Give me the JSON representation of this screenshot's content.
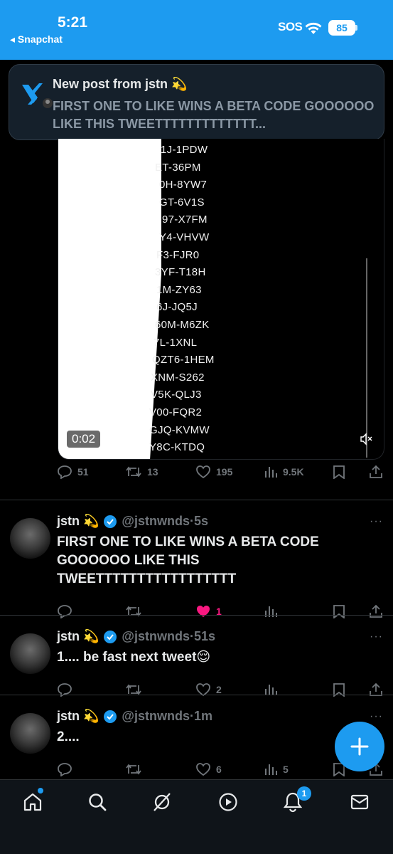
{
  "status_bar": {
    "time": "5:21",
    "back_app": "◂ Snapchat",
    "sos": "SOS",
    "battery": "85"
  },
  "notification": {
    "title": "New post from jstn 💫",
    "body": "FIRST ONE TO LIKE WINS A BETA CODE GOOOOOO LIKE THIS TWEETTTTTTTTTTTTT..."
  },
  "video": {
    "codes": [
      "1J-1PDW",
      "ET-36PM",
      "0H-8YW7",
      "GT-6V1S",
      "97-X7FM",
      "Y4-VHVW",
      "F3-FJR0",
      "3YF-T18H",
      "1M-ZY63",
      "6J-JQ5J",
      "60M-M6ZK",
      "7L-1XNL",
      "QZT6-1HEM",
      "XNM-S262",
      "V5K-QLJ3",
      "V00-FQR2",
      "GJQ-KVMW",
      "Y8C-KTDQ"
    ],
    "timestamp": "0:02"
  },
  "first_post_actions": {
    "replies": "51",
    "reposts": "13",
    "likes": "195",
    "views": "9.5K"
  },
  "tweets": [
    {
      "name": "jstn 💫",
      "handle": "@jstnwnds",
      "time": "·5s",
      "text": "FIRST ONE TO LIKE WINS A BETA CODE GOOOOOO LIKE THIS TWEETTTTTTTTTTTTTTTTT",
      "likes": "1",
      "liked": true,
      "views": ""
    },
    {
      "name": "jstn 💫",
      "handle": "@jstnwnds",
      "time": "·51s",
      "text": "1.... be fast next tweet😌",
      "likes": "2",
      "liked": false,
      "views": ""
    },
    {
      "name": "jstn 💫",
      "handle": "@jstnwnds",
      "time": "·1m",
      "text": "2....",
      "likes": "6",
      "liked": false,
      "views": "5"
    }
  ],
  "nav": {
    "notification_badge": "1"
  },
  "colors": {
    "accent": "#1d9bf0",
    "like": "#f91880",
    "muted": "#71767b"
  }
}
